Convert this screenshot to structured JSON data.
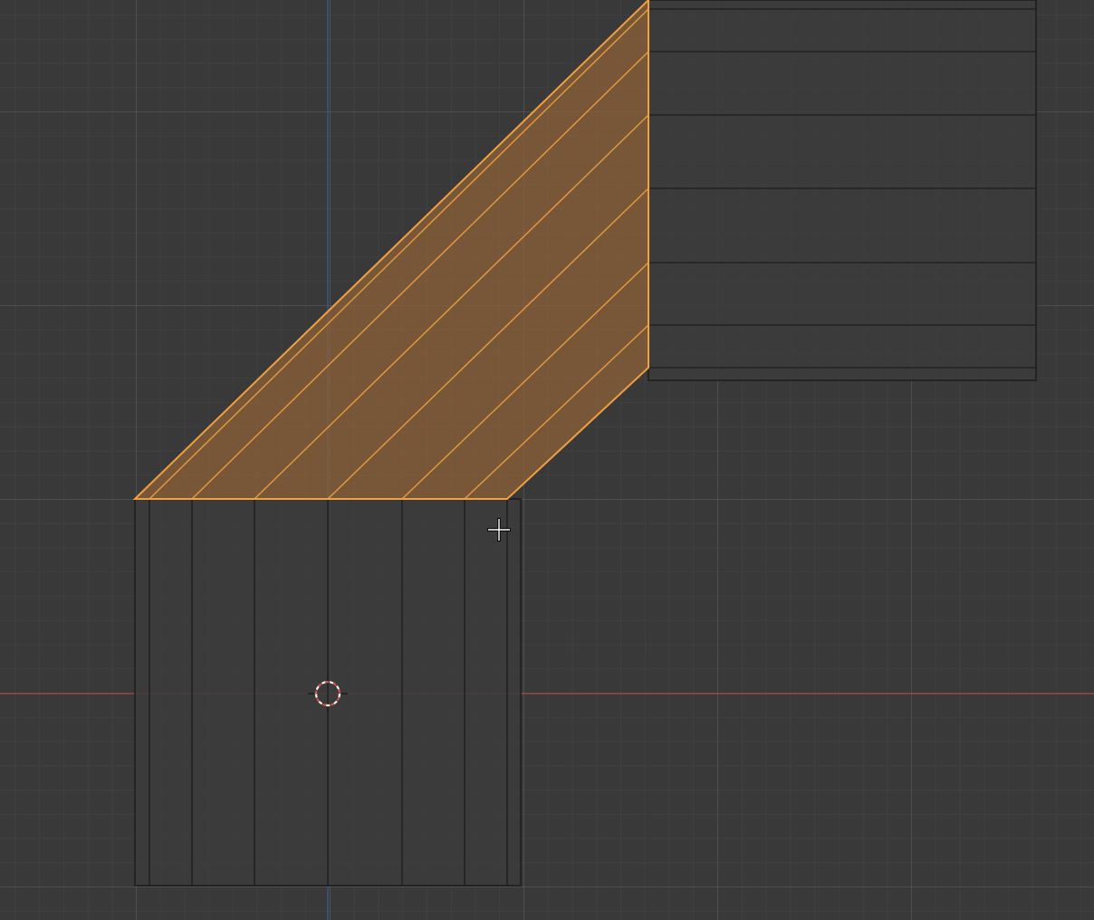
{
  "viewport": {
    "background": "#393939",
    "grid_minor_color": "#404040",
    "grid_major_color": "#4a4a4a",
    "x_axis_color": "#a8463f",
    "y_axis_color": "#3a5a9a"
  },
  "mesh": {
    "face_color": "#3c3c3c",
    "edge_color": "#1c1c1c",
    "selected_face_color": "#7a5a3c",
    "selected_edge_color": "#e89a3c"
  },
  "icons": {
    "origin": "3d-cursor-icon",
    "pointer": "move-crosshair-icon"
  }
}
